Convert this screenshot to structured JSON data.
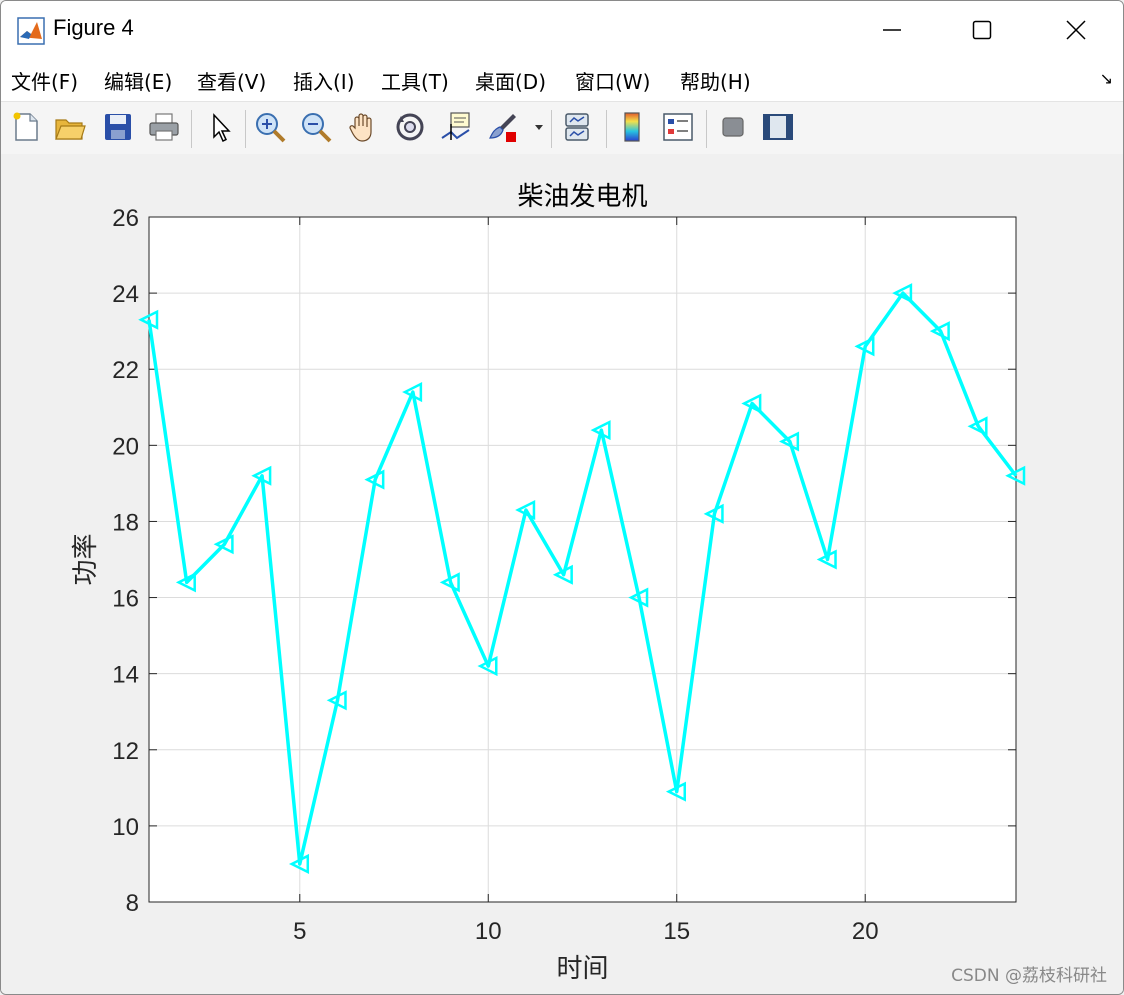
{
  "window": {
    "title": "Figure 4",
    "minimize_icon": "minimize-icon",
    "maximize_icon": "maximize-icon",
    "close_icon": "close-icon"
  },
  "menu": {
    "items": [
      "文件(F)",
      "编辑(E)",
      "查看(V)",
      "插入(I)",
      "工具(T)",
      "桌面(D)",
      "窗口(W)",
      "帮助(H)"
    ],
    "overflow_icon": "↘"
  },
  "toolbar": {
    "icons": [
      "new-figure-icon",
      "open-file-icon",
      "save-icon",
      "print-icon",
      "select-pointer-icon",
      "zoom-in-icon",
      "zoom-out-icon",
      "pan-hand-icon",
      "rotate-3d-icon",
      "data-cursor-icon",
      "brush-icon",
      "link-plot-icon",
      "colorbar-icon",
      "legend-icon",
      "hide-plot-tools-icon",
      "show-plot-tools-icon"
    ]
  },
  "watermark": "CSDN @荔枝科研社",
  "chart_data": {
    "type": "line",
    "title": "柴油发电机",
    "xlabel": "时间",
    "ylabel": "功率",
    "xlim": [
      1,
      24
    ],
    "ylim": [
      8,
      26
    ],
    "xticks": [
      5,
      10,
      15,
      20
    ],
    "yticks": [
      8,
      10,
      12,
      14,
      16,
      18,
      20,
      22,
      24,
      26
    ],
    "grid": true,
    "marker": "triangle-left",
    "color": "#00ffff",
    "series": [
      {
        "x": [
          1,
          2,
          3,
          4,
          5,
          6,
          7,
          8,
          9,
          10,
          11,
          12,
          13,
          14,
          15,
          16,
          17,
          18,
          19,
          20,
          21,
          22,
          23,
          24
        ],
        "values": [
          23.3,
          16.4,
          17.4,
          19.2,
          9.0,
          13.3,
          19.1,
          21.4,
          16.4,
          14.2,
          18.3,
          16.6,
          20.4,
          16.0,
          10.9,
          18.2,
          21.1,
          20.1,
          17.0,
          22.6,
          24.0,
          23.0,
          20.5,
          19.2
        ]
      }
    ]
  }
}
